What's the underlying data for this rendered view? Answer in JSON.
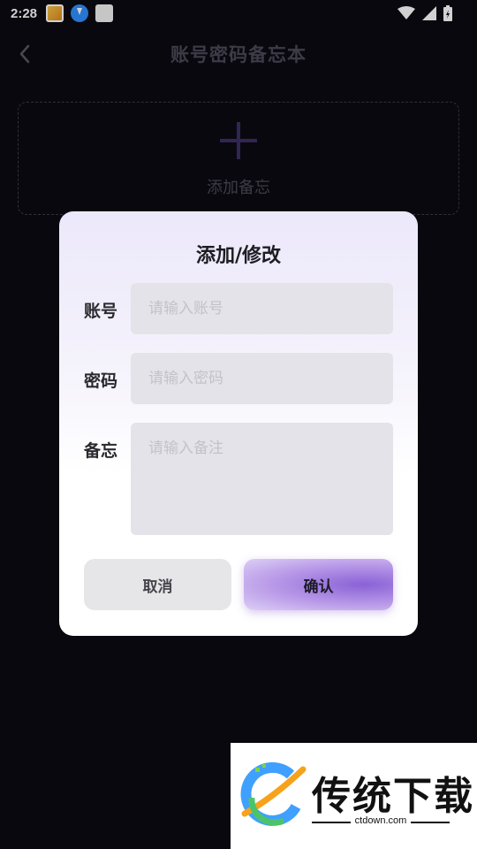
{
  "status_bar": {
    "time": "2:28",
    "icons": [
      "app-notification-icon",
      "download-icon",
      "app-notification-icon",
      "wifi-icon",
      "signal-icon",
      "battery-charging-icon"
    ]
  },
  "header": {
    "title": "账号密码备忘本",
    "back_icon": "chevron-left-icon"
  },
  "add_card": {
    "icon": "plus-icon",
    "label": "添加备忘"
  },
  "dialog": {
    "title": "添加/修改",
    "account": {
      "label": "账号",
      "value": "",
      "placeholder": "请输入账号"
    },
    "password": {
      "label": "密码",
      "value": "",
      "placeholder": "请输入密码"
    },
    "memo": {
      "label": "备忘",
      "value": "",
      "placeholder": "请输入备注"
    },
    "cancel_label": "取消",
    "confirm_label": "确认"
  },
  "watermark": {
    "name": "传统下载",
    "url": "ctdown.com"
  },
  "colors": {
    "background": "#0b0a12",
    "accent_purple": "#8a62d6",
    "plus_icon": "#3c2f66"
  }
}
